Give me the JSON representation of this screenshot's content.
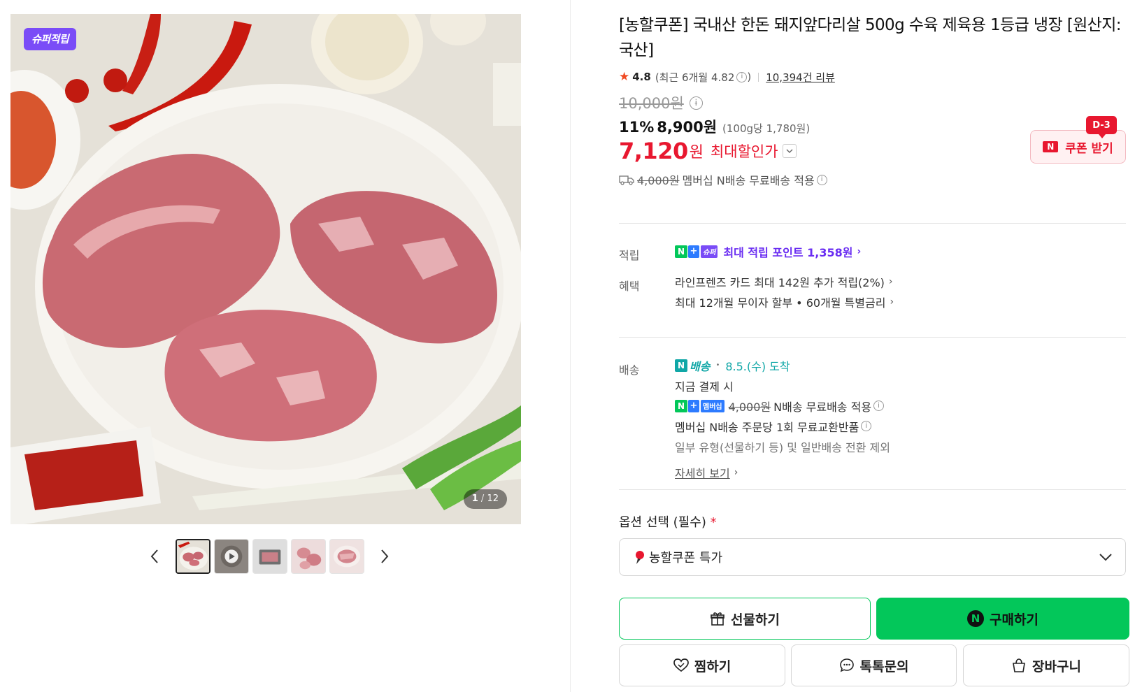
{
  "gallery": {
    "badge": "슈퍼적립",
    "counter_current": "1",
    "counter_sep": " / ",
    "counter_total": "12",
    "thumbnails": [
      "thumb-meat-plate",
      "thumb-video",
      "thumb-package",
      "thumb-meat-closeup",
      "thumb-meat-sliced"
    ]
  },
  "product": {
    "title": "[농할쿠폰] 국내산 한돈 돼지앞다리살 500g 수육 제육용 1등급 냉장 [원산지:국산]",
    "rating": "4.8",
    "recent_rating_prefix": "(최근 6개월 4.82",
    "recent_rating_suffix": ")",
    "review_count": "10,394건 리뷰",
    "original_price": "10,000원",
    "discount_pct": "11%",
    "sale_price": "8,900원",
    "unit_price": "(100g당 1,780원)",
    "max_price": "7,120",
    "max_won": "원",
    "max_label": "최대할인가",
    "shipping_fee": "4,000원",
    "shipping_text": "멤버십 N배송 무료배송 적용"
  },
  "coupon": {
    "label": "쿠폰 받기",
    "d_day": "D-3",
    "n_mark": "N"
  },
  "benefits": {
    "points_label": "적립",
    "points_text": "최대 적립 포인트 1,358원",
    "benefit_label": "혜택",
    "benefit_line1": "라인프렌즈 카드 최대 142원 추가 적립(2%)",
    "benefit_line2": "최대 12개월 무이자 할부 • 60개월 특별금리"
  },
  "delivery": {
    "label": "배송",
    "n_delivery": "배송",
    "arrival": "8.5.(수) 도착",
    "pay_now": "지금 결제 시",
    "member_fee": "4,000원",
    "member_free": "N배송 무료배송 적용",
    "exchange": "멤버십 N배송 주문당 1회 무료교환반품",
    "exclusion": "일부 유형(선물하기 등) 및 일반배송 전환 제외",
    "detail_link": "자세히 보기"
  },
  "tags": {
    "n": "N",
    "plus": "+",
    "super": "슈퍼",
    "membership": "멤버십"
  },
  "option": {
    "label": "옵션 선택 (필수)",
    "required_mark": "*",
    "selected": "농할쿠폰 특가"
  },
  "actions": {
    "gift": "선물하기",
    "buy": "구매하기",
    "buy_n": "N",
    "wish": "찜하기",
    "talk": "톡톡문의",
    "cart": "장바구니"
  },
  "colors": {
    "accent_green": "#03c75a",
    "sale_red": "#e8172f",
    "super_purple": "#7a4cf7",
    "delivery_teal": "#10a7a7"
  }
}
